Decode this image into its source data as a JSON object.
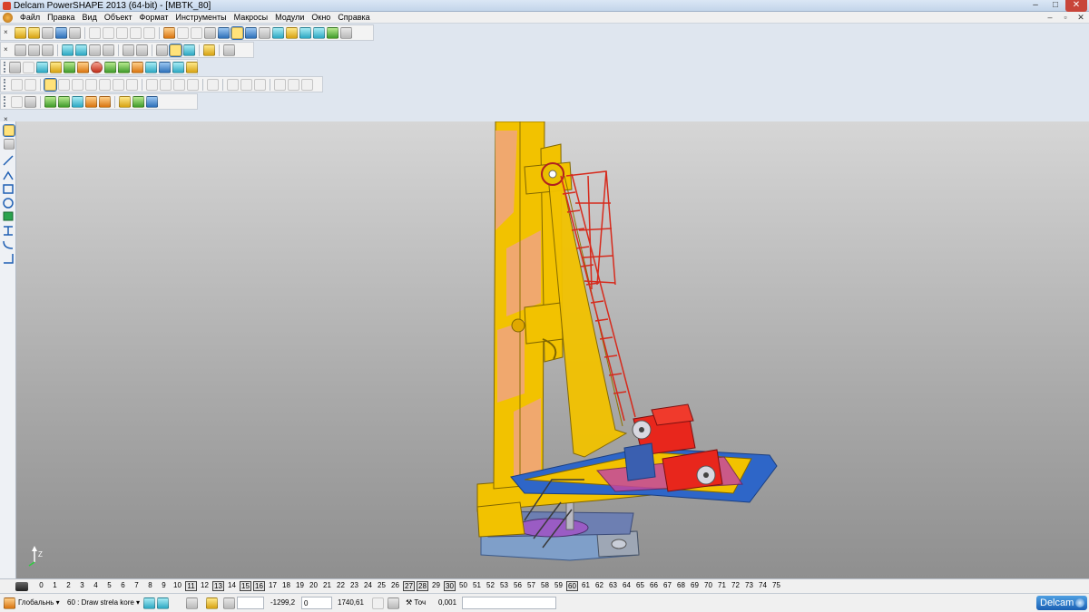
{
  "window": {
    "title": "Delcam PowerSHAPE 2013 (64-bit) - [MBTK_80]",
    "controls": [
      "–",
      "□",
      "✕"
    ]
  },
  "menu": {
    "items": [
      "Файл",
      "Правка",
      "Вид",
      "Объект",
      "Формат",
      "Инструменты",
      "Макросы",
      "Модули",
      "Окно",
      "Справка"
    ],
    "mdi_controls": [
      "–",
      "▫",
      "✕"
    ]
  },
  "toolbars": {
    "close_glyph": "×"
  },
  "levels": {
    "items": [
      "0",
      "1",
      "2",
      "3",
      "4",
      "5",
      "6",
      "7",
      "8",
      "9",
      "10",
      "11",
      "12",
      "13",
      "14",
      "15",
      "16",
      "17",
      "18",
      "19",
      "20",
      "21",
      "22",
      "23",
      "24",
      "25",
      "26",
      "27",
      "28",
      "29",
      "30",
      "50",
      "51",
      "52",
      "53",
      "56",
      "57",
      "58",
      "59",
      "60",
      "61",
      "62",
      "63",
      "64",
      "65",
      "66",
      "67",
      "68",
      "69",
      "70",
      "71",
      "72",
      "73",
      "74",
      "75"
    ],
    "highlighted": [
      "11",
      "13",
      "15",
      "16",
      "27",
      "28",
      "30",
      "60"
    ]
  },
  "status": {
    "workplane": "Глобальнь",
    "level": "60 : Draw strela kore",
    "x": "-1299,2",
    "y": "0",
    "z": "1740,61",
    "tolerance_label": "Точ",
    "tolerance": "0,001",
    "brand": "Delcam"
  },
  "viewport": {
    "axis_label": "Z",
    "colors": {
      "mast": "#f2c200",
      "mast_stripe": "#f0b070",
      "gearbox": "#e8261c",
      "platform": "#2e66c8",
      "base_grey": "#8a8fb0",
      "magenta": "#c447a0"
    }
  }
}
